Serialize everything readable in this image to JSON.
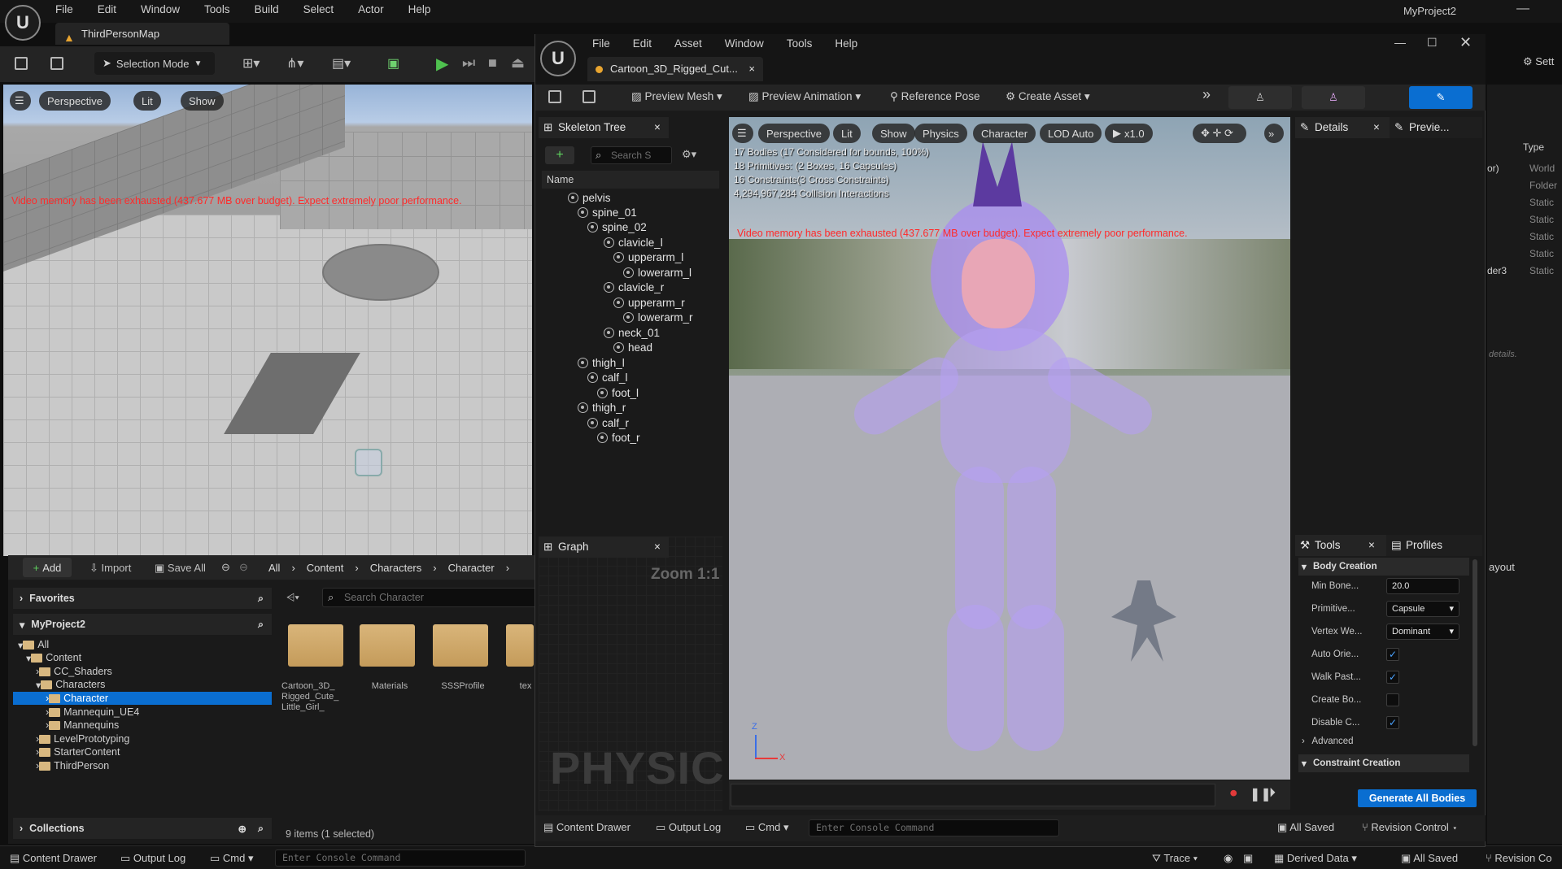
{
  "main": {
    "menu": [
      "File",
      "Edit",
      "Window",
      "Tools",
      "Build",
      "Select",
      "Actor",
      "Help"
    ],
    "project_name": "MyProject2",
    "map_tab": "ThirdPersonMap",
    "selection_mode": "Selection Mode",
    "viewport": {
      "perspective": "Perspective",
      "lit": "Lit",
      "show": "Show",
      "warning": "Video memory has been exhausted (437.677 MB over budget). Expect extremely poor performance."
    }
  },
  "content_browser": {
    "add": "Add",
    "import": "Import",
    "save_all": "Save All",
    "path": [
      "All",
      "Content",
      "Characters",
      "Character"
    ],
    "favorites": "Favorites",
    "project": "MyProject2",
    "search_placeholder": "Search Character",
    "tree": [
      "All",
      "Content",
      "CC_Shaders",
      "Characters",
      "Character",
      "Mannequin_UE4",
      "Mannequins",
      "LevelPrototyping",
      "StarterContent",
      "ThirdPerson"
    ],
    "collections": "Collections",
    "assets": [
      "Cartoon_3D_ Rigged_Cute_ Little_Girl_",
      "Materials",
      "SSSProfile",
      "tex"
    ],
    "item_count": "9 items (1 selected)"
  },
  "status_bar": {
    "content_drawer": "Content Drawer",
    "output_log": "Output Log",
    "cmd": "Cmd",
    "console_placeholder": "Enter Console Command",
    "trace": "Trace",
    "derived_data": "Derived Data",
    "all_saved": "All Saved",
    "revision_control": "Revision Co"
  },
  "outliner_peek": {
    "type_header": "Type",
    "rows": [
      "World",
      "Folder",
      "Static",
      "Static",
      "Static",
      "Static",
      "Static"
    ],
    "row_prefixes": [
      "or)",
      "der3"
    ],
    "settings": "Sett",
    "layout": "ayout",
    "details_hint": "details."
  },
  "asset_editor": {
    "menu": [
      "File",
      "Edit",
      "Asset",
      "Window",
      "Tools",
      "Help"
    ],
    "tab_title": "Cartoon_3D_Rigged_Cut...",
    "toolbar": {
      "preview_mesh": "Preview Mesh",
      "preview_animation": "Preview Animation",
      "reference_pose": "Reference Pose",
      "create_asset": "Create Asset"
    },
    "skeleton_tree": {
      "title": "Skeleton Tree",
      "search_placeholder": "Search S",
      "column_name": "Name",
      "bones": [
        {
          "name": "pelvis",
          "depth": 0
        },
        {
          "name": "spine_01",
          "depth": 1
        },
        {
          "name": "spine_02",
          "depth": 2
        },
        {
          "name": "clavicle_l",
          "depth": 3
        },
        {
          "name": "upperarm_l",
          "depth": 4
        },
        {
          "name": "lowerarm_l",
          "depth": 5
        },
        {
          "name": "clavicle_r",
          "depth": 3
        },
        {
          "name": "upperarm_r",
          "depth": 4
        },
        {
          "name": "lowerarm_r",
          "depth": 5
        },
        {
          "name": "neck_01",
          "depth": 3
        },
        {
          "name": "head",
          "depth": 4
        },
        {
          "name": "thigh_l",
          "depth": 1
        },
        {
          "name": "calf_l",
          "depth": 2
        },
        {
          "name": "foot_l",
          "depth": 3
        },
        {
          "name": "thigh_r",
          "depth": 1
        },
        {
          "name": "calf_r",
          "depth": 2
        },
        {
          "name": "foot_r",
          "depth": 3
        }
      ]
    },
    "graph": {
      "title": "Graph",
      "zoom": "Zoom 1:1",
      "watermark": "PHYSIC"
    },
    "viewport": {
      "pills": [
        "Perspective",
        "Lit",
        "Show",
        "Physics",
        "Character",
        "LOD Auto",
        "x1.0"
      ],
      "stats": [
        "17 Bodies (17 Considered for bounds, 100%)",
        "18 Primitives: (2 Boxes, 16 Capsules)",
        "16 Constraints(3 Cross Constraints)",
        "4,294,967,284 Collision Interactions"
      ],
      "warning": "Video memory has been exhausted (437.677 MB over budget). Expect extremely poor performance.",
      "axis_z": "Z",
      "axis_x": "X"
    },
    "details": {
      "title": "Details",
      "preview_tab": "Previe..."
    },
    "tools": {
      "title": "Tools",
      "profiles": "Profiles",
      "body_creation": "Body Creation",
      "props": [
        {
          "label": "Min Bone...",
          "value": "20.0",
          "kind": "text"
        },
        {
          "label": "Primitive...",
          "value": "Capsule",
          "kind": "select"
        },
        {
          "label": "Vertex We...",
          "value": "Dominant",
          "kind": "select"
        },
        {
          "label": "Auto Orie...",
          "value": "✓",
          "kind": "check"
        },
        {
          "label": "Walk Past...",
          "value": "✓",
          "kind": "check"
        },
        {
          "label": "Create Bo...",
          "value": "",
          "kind": "check"
        },
        {
          "label": "Disable C...",
          "value": "✓",
          "kind": "check"
        }
      ],
      "advanced": "Advanced",
      "constraint_creation": "Constraint Creation",
      "generate": "Generate All Bodies"
    },
    "bottom": {
      "content_drawer": "Content Drawer",
      "output_log": "Output Log",
      "cmd": "Cmd",
      "console_placeholder": "Enter Console Command",
      "all_saved": "All Saved",
      "revision_control": "Revision Control"
    }
  },
  "colors": {
    "accent_blue": "#0a6ed1",
    "warning_red": "#ff2a2a",
    "selection_blue": "#0a6ed1",
    "folder": "#d8b880"
  }
}
